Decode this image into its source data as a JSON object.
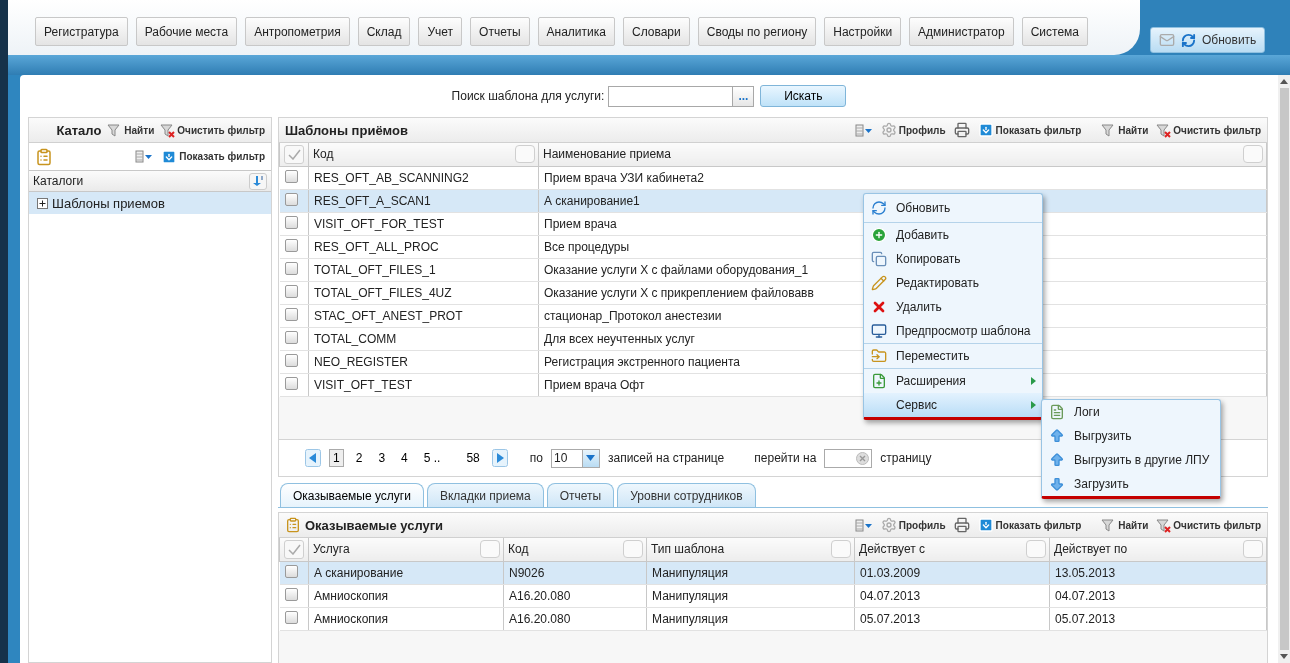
{
  "nav": {
    "items": [
      "Регистратура",
      "Рабочие места",
      "Антропометрия",
      "Склад",
      "Учет",
      "Отчеты",
      "Аналитика",
      "Словари",
      "Своды по региону",
      "Настройки",
      "Администратор",
      "Система"
    ],
    "refresh_button": "Обновить"
  },
  "search": {
    "label": "Поиск шаблона для услуги:",
    "browse_button": "...",
    "button": "Искать"
  },
  "catalog_panel": {
    "title": "Катало",
    "find": "Найти",
    "clear_filter": "Очистить фильтр",
    "show_filter": "Показать фильтр",
    "tree_header": "Каталоги",
    "tree": [
      {
        "label": "Шаблоны приемов",
        "expanded": false,
        "selected": true
      }
    ]
  },
  "templates_panel": {
    "title": "Шаблоны приёмов",
    "toolbar": {
      "profile": "Профиль",
      "show_filter": "Показать фильтр",
      "find": "Найти",
      "clear_filter": "Очистить фильтр"
    },
    "columns": [
      "Код",
      "Наименование приема"
    ],
    "rows": [
      {
        "code": "RES_OFT_AB_SCANNING2",
        "name": "Прием врача УЗИ кабинета2",
        "checked": false,
        "selected": false
      },
      {
        "code": "RES_OFT_A_SCAN1",
        "name": "А сканирование1",
        "checked": false,
        "selected": true
      },
      {
        "code": "VISIT_OFT_FOR_TEST",
        "name": "Прием врача",
        "checked": false,
        "selected": false
      },
      {
        "code": "RES_OFT_ALL_PROC",
        "name": "Все процедуры",
        "checked": false,
        "selected": false
      },
      {
        "code": "TOTAL_OFT_FILES_1",
        "name": "Оказание услуги X с файлами оборудования_1",
        "checked": false,
        "selected": false
      },
      {
        "code": "TOTAL_OFT_FILES_4UZ",
        "name": "Оказание услуги X с прикреплением файловавв",
        "checked": false,
        "selected": false
      },
      {
        "code": "STAC_OFT_ANEST_PROT",
        "name": "стационар_Протокол анестезии",
        "checked": false,
        "selected": false
      },
      {
        "code": "TOTAL_COMM",
        "name": "Для всех неучтенных услуг",
        "checked": false,
        "selected": false
      },
      {
        "code": "NEO_REGISTER",
        "name": "Регистрация экстренного пациента",
        "checked": false,
        "selected": false
      },
      {
        "code": "VISIT_OFT_TEST",
        "name": "Прием врача Офт",
        "checked": false,
        "selected": false
      }
    ],
    "pager": {
      "pages": [
        {
          "label": "1",
          "selected": true
        },
        {
          "label": "2",
          "selected": false
        },
        {
          "label": "3",
          "selected": false
        },
        {
          "label": "4",
          "selected": false
        },
        {
          "label": "5 ..",
          "selected": false
        },
        {
          "label": "58",
          "selected": false
        }
      ],
      "per_page_label": "по",
      "per_page": "10",
      "records_label": "записей на странице",
      "goto_label": "перейти на",
      "goto_suffix": "страницу"
    }
  },
  "tabs": [
    {
      "label": "Оказываемые услуги",
      "selected": true
    },
    {
      "label": "Вкладки приема",
      "selected": false
    },
    {
      "label": "Отчеты",
      "selected": false
    },
    {
      "label": "Уровни сотрудников",
      "selected": false
    }
  ],
  "services_panel": {
    "title": "Оказываемые услуги",
    "toolbar": {
      "profile": "Профиль",
      "show_filter": "Показать фильтр",
      "find": "Найти",
      "clear_filter": "Очистить фильтр"
    },
    "columns": [
      "Услуга",
      "Код",
      "Тип шаблона",
      "Действует с",
      "Действует по"
    ],
    "rows": [
      {
        "cells": [
          "А сканирование",
          "N9026",
          "Манипуляция",
          "01.03.2009",
          "13.05.2013"
        ],
        "checked": false,
        "selected": true
      },
      {
        "cells": [
          "Амниоскопия",
          "A16.20.080",
          "Манипуляция",
          "04.07.2013",
          "04.07.2013"
        ],
        "checked": false,
        "selected": false
      },
      {
        "cells": [
          "Амниоскопия",
          "A16.20.080",
          "Манипуляция",
          "05.07.2013",
          "05.07.2013"
        ],
        "checked": false,
        "selected": false
      }
    ]
  },
  "context_menu": {
    "groups": [
      [
        {
          "label": "Обновить",
          "has_submenu": false,
          "selected": false
        }
      ],
      [
        {
          "label": "Добавить",
          "has_submenu": false,
          "selected": false
        },
        {
          "label": "Копировать",
          "has_submenu": false,
          "selected": false
        },
        {
          "label": "Редактировать",
          "has_submenu": false,
          "selected": false
        },
        {
          "label": "Удалить",
          "has_submenu": false,
          "selected": false
        },
        {
          "label": "Предпросмотр шаблона",
          "has_submenu": false,
          "selected": false
        }
      ],
      [
        {
          "label": "Переместить",
          "has_submenu": false,
          "selected": false
        }
      ],
      [
        {
          "label": "Расширения",
          "has_submenu": true,
          "selected": false
        },
        {
          "label": "Сервис",
          "has_submenu": true,
          "selected": true
        }
      ]
    ]
  },
  "submenu": {
    "items": [
      "Логи",
      "Выгрузить",
      "Выгрузить в другие ЛПУ",
      "Загрузить"
    ]
  }
}
